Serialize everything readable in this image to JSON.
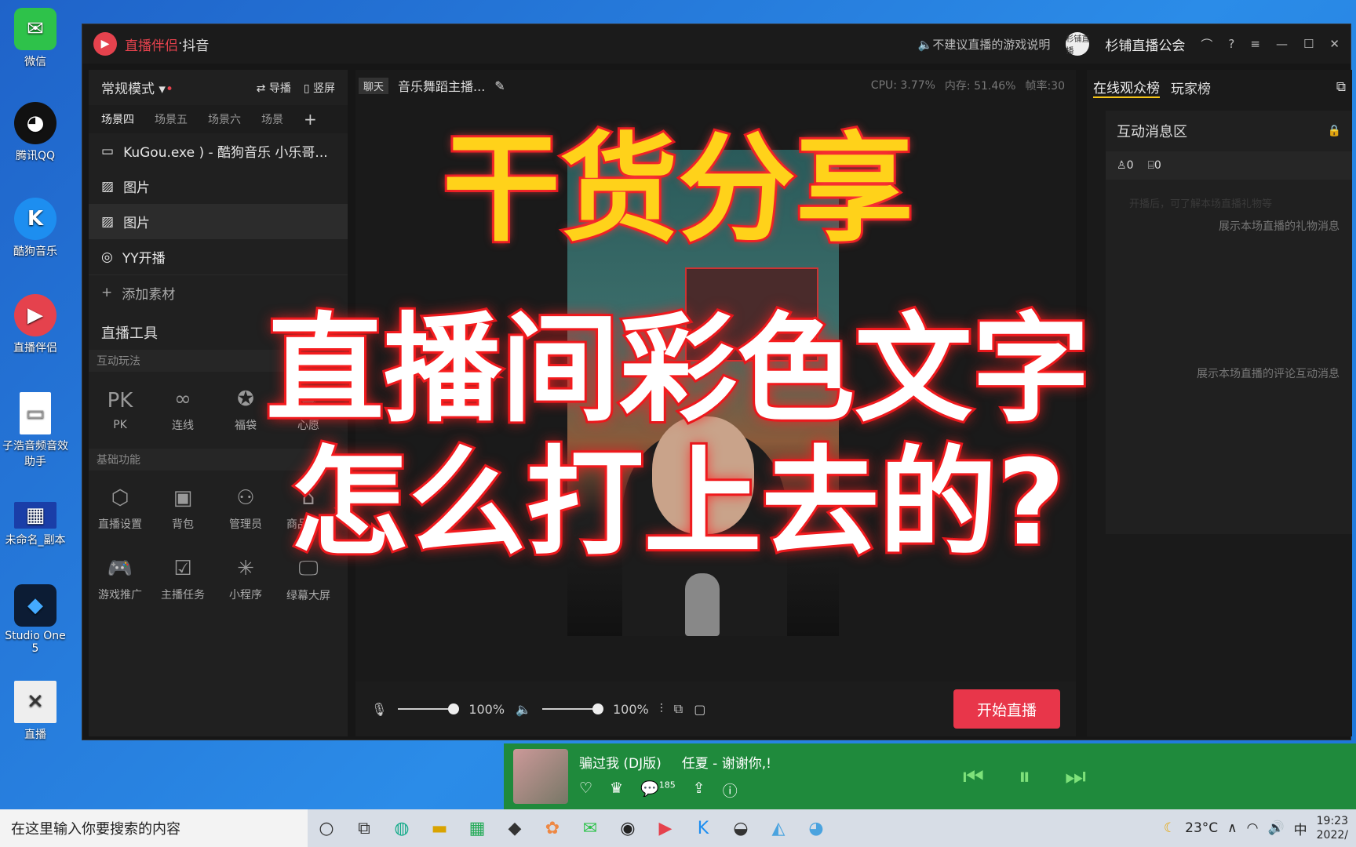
{
  "desktop": {
    "icons": [
      "微信",
      "腾讯QQ",
      "酷狗音乐",
      "直播伴侣",
      "子浩音频音效助手",
      "未命名_副本",
      "Studio One 5",
      "直播"
    ]
  },
  "titlebar": {
    "brand": "直播伴侣",
    "separator": " · ",
    "product": "抖音",
    "notice": "不建议直播的游戏说明",
    "avatar_text": "杉铺直播",
    "user": "杉铺直播公会"
  },
  "sidebar": {
    "mode": "常规模式",
    "guide": "导播",
    "portrait": "竖屏",
    "tabs": [
      "场景四",
      "场景五",
      "场景六",
      "场景"
    ],
    "sources": [
      "KuGou.exe ) - 酷狗音乐 小乐哥...",
      "图片",
      "图片",
      "YY开播"
    ],
    "add": "添加素材",
    "tools_title": "直播工具",
    "sec_play": "互动玩法",
    "play_tools": [
      "PK",
      "连线",
      "福袋",
      "心愿"
    ],
    "sec_basic": "基础功能",
    "basic_tools": [
      "直播设置",
      "背包",
      "管理员",
      "商品管理",
      "游戏推广",
      "主播任务",
      "小程序",
      "绿幕大屏"
    ]
  },
  "center": {
    "tag": "聊天",
    "title": "音乐舞蹈主播...",
    "cpu": "CPU: 3.77%",
    "mem": "内存: 51.46%",
    "fps": "帧率:30",
    "mic_vol": "100%",
    "spk_vol": "100%",
    "start": "开始直播"
  },
  "right": {
    "tab1": "在线观众榜",
    "tab2": "玩家榜",
    "panel_title": "互动消息区",
    "viewers": "0",
    "gifts": "0",
    "hint_faded": "开播后，可了解本场直播礼物等",
    "gift_hint": "展示本场直播的礼物消息",
    "comment_hint": "展示本场直播的评论互动消息"
  },
  "overlay": {
    "line1": "干货分享",
    "line2": "直播间彩色文字",
    "line3": "怎么打上去的?"
  },
  "music": {
    "song": "骗过我 (DJ版)",
    "artist": "任夏 - 谢谢你,! ",
    "count": "185"
  },
  "taskbar": {
    "search": "在这里输入你要搜索的内容",
    "temp": "23°C",
    "ime": "中",
    "time": "19:23",
    "date": "2022/"
  },
  "colors": {
    "accent": "#e8364a",
    "title_red": "#e2151c",
    "yellow": "#ffd21a",
    "music_green": "#1f8a3c"
  }
}
